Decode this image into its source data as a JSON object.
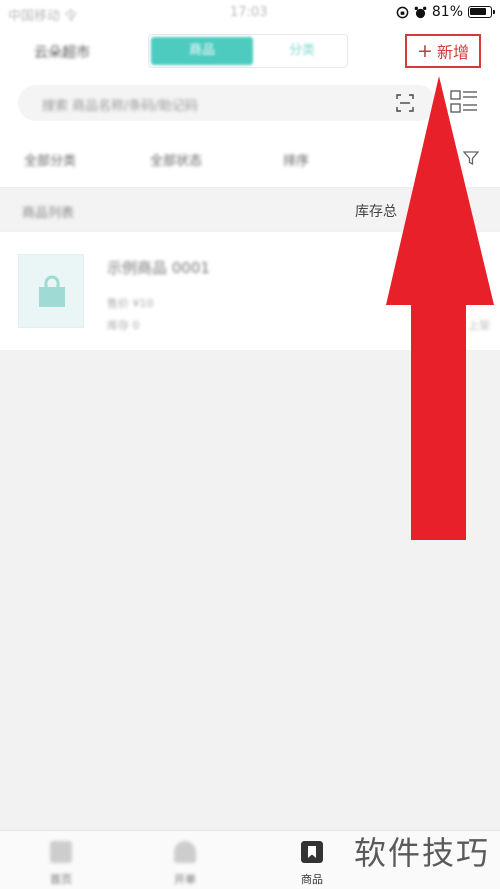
{
  "status_bar": {
    "carrier": "中国移动 令",
    "time": "17:03",
    "battery": "81%"
  },
  "header": {
    "store_name": "云朵超市",
    "seg_active": "商品",
    "seg_inactive": "分类",
    "add_label": "新增"
  },
  "search": {
    "placeholder": "搜索 商品名称/条码/助记码"
  },
  "filters": {
    "item1": "全部分类",
    "item2": "全部状态",
    "item3": "排序"
  },
  "summary": {
    "left_label": "商品列表",
    "right_label": "库存总"
  },
  "product": {
    "name": "示例商品 0001",
    "meta_line1": "售价 ¥10",
    "meta_line2": "库存 0",
    "side_text": "上架"
  },
  "tabbar": {
    "tabs": [
      {
        "label": "首页"
      },
      {
        "label": "开单"
      },
      {
        "label": "商品"
      }
    ]
  },
  "watermark": "软件技巧",
  "colors": {
    "accent": "#4dcbbf",
    "highlight_red": "#d43a3a",
    "arrow_red": "#e8202a"
  }
}
